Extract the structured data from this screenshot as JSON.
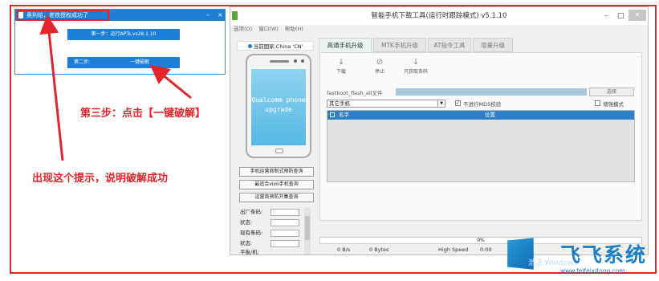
{
  "dialog": {
    "title": "奥利给，老铁授权成功了",
    "minimize": "–",
    "close": "×",
    "step1": "第一步：运行APTs.vs28.1.10",
    "step2_label": "第二步:",
    "step2_action": "一键破解"
  },
  "annotations": {
    "step3": "第三步：点击【一键破解】",
    "success": "出现这个提示，说明破解成功"
  },
  "window": {
    "title": "智能手机下载工具(运行时跟踪模式)  v5.1.10",
    "minimize": "–",
    "maximize": "□",
    "close": "×",
    "menu": [
      "选项(O)",
      "窗口(W)",
      "帮助(H)"
    ],
    "country": "当前国家:China 'CN'",
    "phone_screen": "Qualcomm phone upgrade",
    "left_buttons": [
      "手机运营商制式预防查询",
      "最适合vivo手机查询",
      "运营商预防开集查询"
    ],
    "fields": [
      "出厂条码:",
      "状态:",
      "现有条码:",
      "状态:",
      "平板/机:"
    ],
    "tabs": [
      "高通手机升级",
      "MTK手机升级",
      "AT指令工具",
      "增量升级"
    ],
    "tools": [
      "下载",
      "停止",
      "只获取条码"
    ],
    "fastboot_label": "fastboot_flash_all文件",
    "select_button": "选择",
    "dropdown_value": "其它手机",
    "no_md5": "不进行MD5校验",
    "incremental_mode": "增强模式",
    "grid_headers": [
      "名字",
      "位置"
    ],
    "progress_text": "0%",
    "speed": "0 B/s",
    "bytes": "0 Bytes",
    "mode": "High Speed",
    "time": "0:00"
  },
  "watermark": {
    "brand": "飞飞系统",
    "url": "www.feifeixitong.com",
    "ghost": "激活 Windows"
  }
}
